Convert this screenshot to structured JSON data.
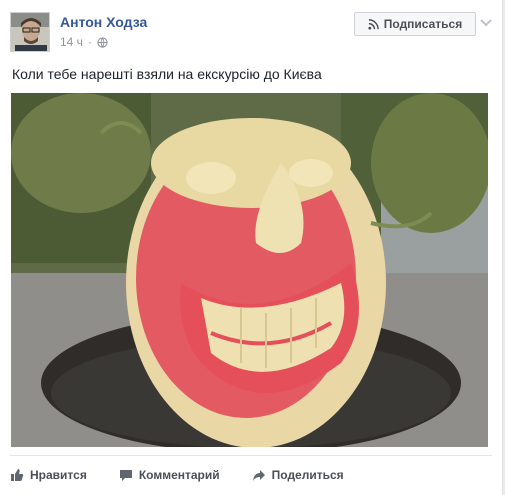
{
  "post": {
    "author": "Антон Ходза",
    "time": "14 ч",
    "follow_label": "Подписаться",
    "text": "Коли тебе нарешті взяли на екскурсію до Києва"
  },
  "actions": {
    "like": "Нравится",
    "comment": "Комментарий",
    "share": "Поделиться"
  },
  "icons": {
    "follow": "rss-icon",
    "privacy": "globe-icon",
    "menu": "chevron-down-icon",
    "like": "thumbs-up-icon",
    "comment": "comment-icon",
    "share": "share-arrow-icon"
  },
  "colors": {
    "author_link": "#365899",
    "meta": "#90949c",
    "action_text": "#4b4f56",
    "page_bg": "#e9ebee"
  }
}
